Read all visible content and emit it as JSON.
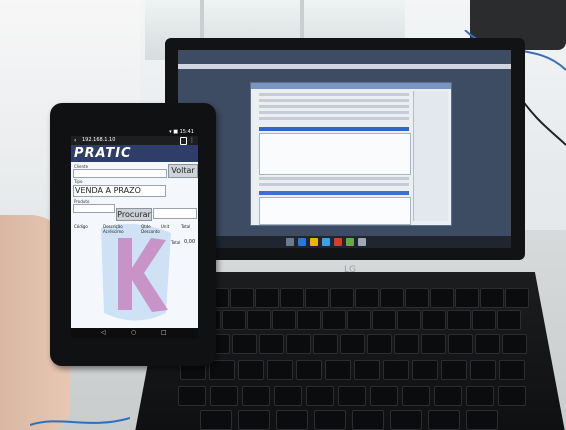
{
  "scene": {
    "description_visible": false
  },
  "phone": {
    "status": {
      "time": "15:41",
      "icons": "▾ ■"
    },
    "action_bar": {
      "title": "192.168.1.10",
      "back_icon": "back-icon",
      "cart_icon": "cart-icon",
      "overflow_icon": "overflow-icon"
    },
    "logo": "PRATIC",
    "form": {
      "cliente_label": "Cliente",
      "voltar_button": "Voltar",
      "venda_label": "Tipo",
      "venda_value": "VENDA A PRAZO",
      "produto_label": "Produto",
      "procurar_button": "Procurar"
    },
    "table": {
      "headers": [
        "Código",
        "Descrição",
        "Qtde",
        "Unit",
        "Total"
      ],
      "subheaders": [
        "Acréscimo",
        "Desconto"
      ]
    },
    "total": {
      "label": "Total",
      "value": "0,00"
    },
    "navbar": {
      "back": "◁",
      "home": "○",
      "recent": "□"
    }
  },
  "laptop": {
    "brand": "LG",
    "screen_text_readable": false
  }
}
